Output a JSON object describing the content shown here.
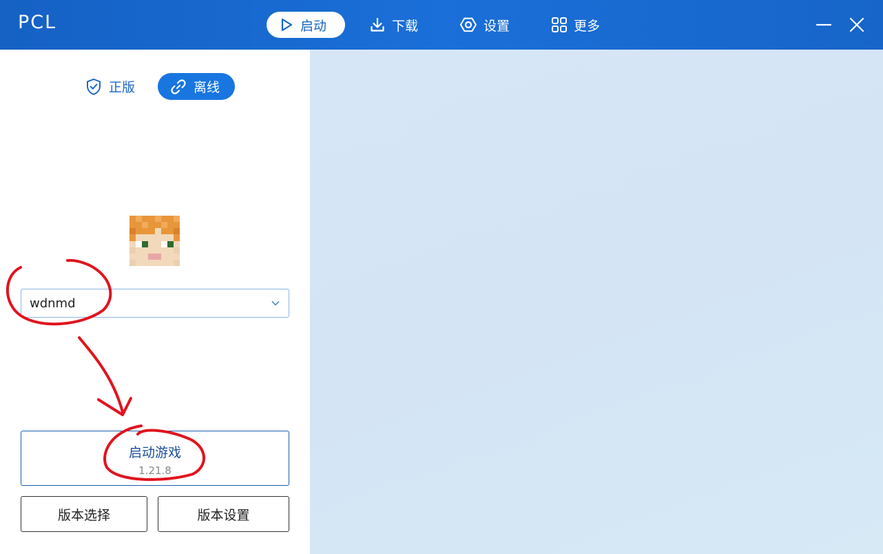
{
  "app": {
    "title": "PCL"
  },
  "nav": {
    "launch": "启动",
    "download": "下载",
    "settings": "设置",
    "more": "更多"
  },
  "account": {
    "premium_tab": "正版",
    "offline_tab": "离线",
    "selected_mode": "离线"
  },
  "user": {
    "avatar_icon": "player-head-icon",
    "selected_name": "wdnmd"
  },
  "launch": {
    "label": "启动游戏",
    "version": "1.21.8"
  },
  "buttons": {
    "version_select": "版本选择",
    "version_settings": "版本设置"
  },
  "colors": {
    "accent": "#1976e0",
    "titlebar": "#1a6fd8",
    "annotation": "#e0141e"
  },
  "icons": {
    "launch": "play-icon",
    "download": "download-icon",
    "settings": "hexagon-gear-icon",
    "more": "grid-icon",
    "premium": "shield-check-icon",
    "offline": "link-icon",
    "minimize": "minimize-icon",
    "close": "close-icon"
  }
}
